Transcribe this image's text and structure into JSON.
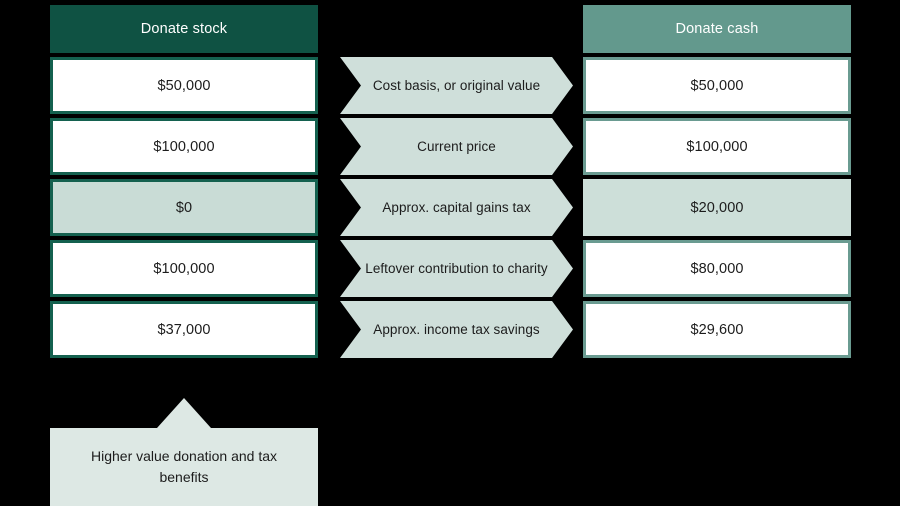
{
  "colors": {
    "background": "#000000",
    "stock_header_bg": "#0f5243",
    "stock_border": "#14614f",
    "cash_header_bg": "#63998d",
    "cash_border": "#6a9b91",
    "highlight_fill": "#c9dcd6",
    "banner_fill": "#cfdfda",
    "callout_fill": "#dde8e4",
    "text_dark": "#1c1c1c",
    "text_light": "#ffffff"
  },
  "columns": {
    "stock": {
      "header": "Donate stock",
      "cells": [
        {
          "value": "$50,000",
          "highlighted": false
        },
        {
          "value": "$100,000",
          "highlighted": false
        },
        {
          "value": "$0",
          "highlighted": true
        },
        {
          "value": "$100,000",
          "highlighted": false
        },
        {
          "value": "$37,000",
          "highlighted": false
        }
      ]
    },
    "cash": {
      "header": "Donate cash",
      "cells": [
        {
          "value": "$50,000",
          "highlighted": false
        },
        {
          "value": "$100,000",
          "highlighted": false
        },
        {
          "value": "$20,000",
          "highlighted": true
        },
        {
          "value": "$80,000",
          "highlighted": false
        },
        {
          "value": "$29,600",
          "highlighted": false
        }
      ]
    }
  },
  "middle_labels": [
    "Cost basis, or original value",
    "Current price",
    "Approx. capital gains tax",
    "Leftover contribution to charity",
    "Approx. income tax savings"
  ],
  "callout": {
    "text": "Higher value donation and tax benefits",
    "pointer_icon": "triangle-up-icon"
  }
}
